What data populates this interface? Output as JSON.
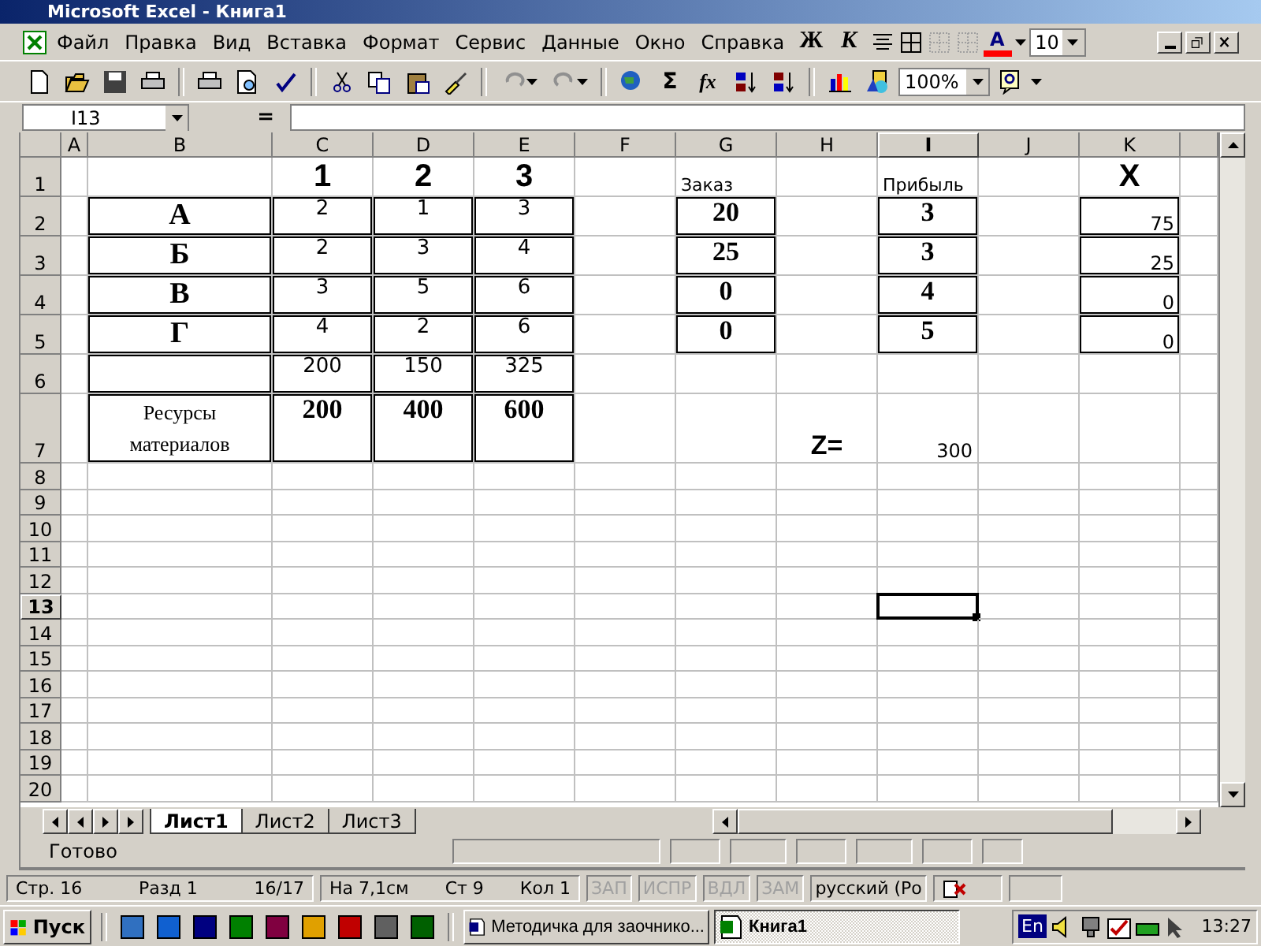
{
  "window": {
    "title": "Microsoft Excel - Книга1"
  },
  "menu": [
    "Файл",
    "Правка",
    "Вид",
    "Вставка",
    "Формат",
    "Сервис",
    "Данные",
    "Окно",
    "Справка"
  ],
  "formatting": {
    "bold": "Ж",
    "italic": "К",
    "font_color": "A",
    "font_size": "10"
  },
  "standard_toolbar": {
    "sum": "Σ",
    "function": "fx",
    "zoom": "100%"
  },
  "formula_bar": {
    "name_box": "I13",
    "equals": "="
  },
  "columns": [
    {
      "label": "A",
      "selected": false
    },
    {
      "label": "B",
      "selected": false
    },
    {
      "label": "C",
      "selected": false
    },
    {
      "label": "D",
      "selected": false
    },
    {
      "label": "E",
      "selected": false
    },
    {
      "label": "F",
      "selected": false
    },
    {
      "label": "G",
      "selected": false
    },
    {
      "label": "H",
      "selected": false
    },
    {
      "label": "I",
      "selected": true
    },
    {
      "label": "J",
      "selected": false
    },
    {
      "label": "K",
      "selected": false
    }
  ],
  "rows": [
    {
      "label": "1",
      "selected": false,
      "tall": false,
      "cells": [
        {
          "kind": "empty",
          "selected": false
        },
        {
          "kind": "empty",
          "selected": false
        },
        {
          "kind": "heading",
          "text": "1",
          "selected": false
        },
        {
          "kind": "heading",
          "text": "2",
          "selected": false
        },
        {
          "kind": "heading",
          "text": "3",
          "selected": false
        },
        {
          "kind": "empty",
          "selected": false
        },
        {
          "kind": "label",
          "text": "Заказ",
          "selected": false
        },
        {
          "kind": "empty",
          "selected": false
        },
        {
          "kind": "label",
          "text": "Прибыль",
          "selected": false
        },
        {
          "kind": "empty",
          "selected": false
        },
        {
          "kind": "heading",
          "text": "X",
          "selected": false
        }
      ]
    },
    {
      "label": "2",
      "selected": false,
      "tall": false,
      "cells": [
        {
          "kind": "empty",
          "selected": false
        },
        {
          "kind": "letter",
          "text": "А",
          "selected": false
        },
        {
          "kind": "num",
          "text": "2",
          "selected": false
        },
        {
          "kind": "num",
          "text": "1",
          "selected": false
        },
        {
          "kind": "num",
          "text": "3",
          "selected": false
        },
        {
          "kind": "empty",
          "selected": false
        },
        {
          "kind": "serif",
          "text": "20",
          "selected": false
        },
        {
          "kind": "empty",
          "selected": false
        },
        {
          "kind": "serif",
          "text": "3",
          "selected": false
        },
        {
          "kind": "empty",
          "selected": false
        },
        {
          "kind": "right",
          "text": "75",
          "selected": false
        }
      ]
    },
    {
      "label": "3",
      "selected": false,
      "tall": false,
      "cells": [
        {
          "kind": "empty",
          "selected": false
        },
        {
          "kind": "letter",
          "text": "Б",
          "selected": false
        },
        {
          "kind": "num",
          "text": "2",
          "selected": false
        },
        {
          "kind": "num",
          "text": "3",
          "selected": false
        },
        {
          "kind": "num",
          "text": "4",
          "selected": false
        },
        {
          "kind": "empty",
          "selected": false
        },
        {
          "kind": "serif",
          "text": "25",
          "selected": false
        },
        {
          "kind": "empty",
          "selected": false
        },
        {
          "kind": "serif",
          "text": "3",
          "selected": false
        },
        {
          "kind": "empty",
          "selected": false
        },
        {
          "kind": "right",
          "text": "25",
          "selected": false
        }
      ]
    },
    {
      "label": "4",
      "selected": false,
      "tall": false,
      "cells": [
        {
          "kind": "empty",
          "selected": false
        },
        {
          "kind": "letter",
          "text": "В",
          "selected": false
        },
        {
          "kind": "num",
          "text": "3",
          "selected": false
        },
        {
          "kind": "num",
          "text": "5",
          "selected": false
        },
        {
          "kind": "num",
          "text": "6",
          "selected": false
        },
        {
          "kind": "empty",
          "selected": false
        },
        {
          "kind": "serif",
          "text": "0",
          "selected": false
        },
        {
          "kind": "empty",
          "selected": false
        },
        {
          "kind": "serif",
          "text": "4",
          "selected": false
        },
        {
          "kind": "empty",
          "selected": false
        },
        {
          "kind": "right",
          "text": "0",
          "selected": false
        }
      ]
    },
    {
      "label": "5",
      "selected": false,
      "tall": false,
      "cells": [
        {
          "kind": "empty",
          "selected": false
        },
        {
          "kind": "letter",
          "text": "Г",
          "selected": false
        },
        {
          "kind": "num",
          "text": "4",
          "selected": false
        },
        {
          "kind": "num",
          "text": "2",
          "selected": false
        },
        {
          "kind": "num",
          "text": "6",
          "selected": false
        },
        {
          "kind": "empty",
          "selected": false
        },
        {
          "kind": "serif",
          "text": "0",
          "selected": false
        },
        {
          "kind": "empty",
          "selected": false
        },
        {
          "kind": "serif",
          "text": "5",
          "selected": false
        },
        {
          "kind": "empty",
          "selected": false
        },
        {
          "kind": "right",
          "text": "0",
          "selected": false
        }
      ]
    },
    {
      "label": "6",
      "selected": false,
      "tall": false,
      "cells": [
        {
          "kind": "empty",
          "selected": false
        },
        {
          "kind": "box",
          "selected": false
        },
        {
          "kind": "num",
          "text": "200",
          "selected": false
        },
        {
          "kind": "num",
          "text": "150",
          "selected": false
        },
        {
          "kind": "num",
          "text": "325",
          "selected": false
        },
        {
          "kind": "empty",
          "selected": false
        },
        {
          "kind": "empty",
          "selected": false
        },
        {
          "kind": "empty",
          "selected": false
        },
        {
          "kind": "empty",
          "selected": false
        },
        {
          "kind": "empty",
          "selected": false
        },
        {
          "kind": "empty",
          "selected": false
        }
      ]
    },
    {
      "label": "7",
      "selected": false,
      "tall": true,
      "cells": [
        {
          "kind": "empty",
          "selected": false
        },
        {
          "kind": "resource",
          "text": "Ресурсы материалов",
          "selected": false
        },
        {
          "kind": "serif",
          "text": "200",
          "selected": false
        },
        {
          "kind": "serif",
          "text": "400",
          "selected": false
        },
        {
          "kind": "serif",
          "text": "600",
          "selected": false
        },
        {
          "kind": "empty",
          "selected": false
        },
        {
          "kind": "empty",
          "selected": false
        },
        {
          "kind": "z",
          "text": "Z=",
          "selected": false
        },
        {
          "kind": "value",
          "text": "300",
          "selected": false
        },
        {
          "kind": "empty",
          "selected": false
        },
        {
          "kind": "empty",
          "selected": false
        }
      ]
    },
    {
      "label": "8",
      "selected": false,
      "tall": false,
      "cells": []
    },
    {
      "label": "9",
      "selected": false,
      "tall": false,
      "cells": []
    },
    {
      "label": "10",
      "selected": false,
      "tall": false,
      "cells": []
    },
    {
      "label": "11",
      "selected": false,
      "tall": false,
      "cells": []
    },
    {
      "label": "12",
      "selected": false,
      "tall": false,
      "cells": []
    },
    {
      "label": "13",
      "selected": true,
      "tall": false,
      "cells": [
        {
          "kind": "empty",
          "selected": false
        },
        {
          "kind": "empty",
          "selected": false
        },
        {
          "kind": "empty",
          "selected": false
        },
        {
          "kind": "empty",
          "selected": false
        },
        {
          "kind": "empty",
          "selected": false
        },
        {
          "kind": "empty",
          "selected": false
        },
        {
          "kind": "empty",
          "selected": false
        },
        {
          "kind": "empty",
          "selected": false
        },
        {
          "kind": "empty",
          "selected": true
        },
        {
          "kind": "empty",
          "selected": false
        },
        {
          "kind": "empty",
          "selected": false
        }
      ]
    },
    {
      "label": "14",
      "selected": false,
      "tall": false,
      "cells": []
    },
    {
      "label": "15",
      "selected": false,
      "tall": false,
      "cells": []
    },
    {
      "label": "16",
      "selected": false,
      "tall": false,
      "cells": []
    },
    {
      "label": "17",
      "selected": false,
      "tall": false,
      "cells": []
    },
    {
      "label": "18",
      "selected": false,
      "tall": false,
      "cells": []
    },
    {
      "label": "19",
      "selected": false,
      "tall": false,
      "cells": []
    },
    {
      "label": "20",
      "selected": false,
      "tall": false,
      "cells": []
    }
  ],
  "sheet_tabs": [
    {
      "label": "Лист1",
      "selected": true
    },
    {
      "label": "Лист2",
      "selected": false
    },
    {
      "label": "Лист3",
      "selected": false
    }
  ],
  "excel_status": "Готово",
  "word_status": {
    "page": [
      "Стр. 16",
      "Разд 1",
      "16/17"
    ],
    "position": [
      "На 7,1см",
      "Ст 9",
      "Кол 1"
    ],
    "indicators": [
      {
        "label": "ЗАП",
        "disabled": true
      },
      {
        "label": "ИСПР",
        "disabled": true
      },
      {
        "label": "ВДЛ",
        "disabled": true
      },
      {
        "label": "ЗАМ",
        "disabled": true
      }
    ],
    "language": "русский (Ро"
  },
  "taskbar": {
    "start": "Пуск",
    "tasks": [
      {
        "label": "Методичка для заочнико...",
        "selected": false
      },
      {
        "label": "Книга1",
        "selected": true
      }
    ],
    "language": "En",
    "clock": "13:27"
  }
}
